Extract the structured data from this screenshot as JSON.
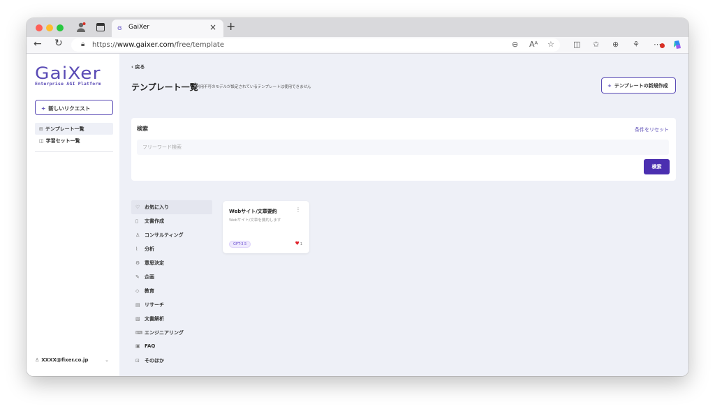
{
  "browser": {
    "tab_title": "GaiXer",
    "tab_close": "×",
    "new_tab": "+",
    "url_prefix": "https://",
    "url_host": "www.gaixer.com",
    "url_path": "/free/template",
    "icons": [
      "zoom-icon",
      "read-aloud-icon",
      "favorite-star-icon",
      "split-screen-icon",
      "favorites-list-icon",
      "collections-icon",
      "extensions-icon",
      "more-icon",
      "copilot-icon"
    ]
  },
  "sidebar": {
    "logo": "GaiXer",
    "tagline": "Enterprise AGI Platform",
    "new_request": "新しいリクエスト",
    "items": [
      {
        "label": "テンプレート一覧",
        "icon": "template-icon",
        "active": true
      },
      {
        "label": "学習セット一覧",
        "icon": "book-icon",
        "active": false
      }
    ],
    "user": "XXXX@fixer.co.jp"
  },
  "main": {
    "back": "戻る",
    "title": "テンプレート一覧",
    "note": "利用不可のモデルが設定されているテンプレートは使用できません",
    "new_template": "テンプレートの新規作成",
    "search": {
      "title": "検索",
      "reset": "条件をリセット",
      "placeholder": "フリーワード検索",
      "button": "検索"
    },
    "categories": [
      {
        "label": "お気に入り",
        "icon": "heart-icon",
        "glyph": "♡"
      },
      {
        "label": "文書作成",
        "icon": "document-icon",
        "glyph": "▯"
      },
      {
        "label": "コンサルティング",
        "icon": "person-icon",
        "glyph": "♙"
      },
      {
        "label": "分析",
        "icon": "chart-icon",
        "glyph": "⌇"
      },
      {
        "label": "意思決定",
        "icon": "decision-icon",
        "glyph": "⚙"
      },
      {
        "label": "企画",
        "icon": "pen-icon",
        "glyph": "✎"
      },
      {
        "label": "教育",
        "icon": "graduation-icon",
        "glyph": "◇"
      },
      {
        "label": "リサーチ",
        "icon": "research-icon",
        "glyph": "▤"
      },
      {
        "label": "文書解析",
        "icon": "document-analysis-icon",
        "glyph": "▧"
      },
      {
        "label": "エンジニアリング",
        "icon": "code-icon",
        "glyph": "⌨"
      },
      {
        "label": "FAQ",
        "icon": "faq-icon",
        "glyph": "▣"
      },
      {
        "label": "そのほか",
        "icon": "other-icon",
        "glyph": "⊡"
      }
    ],
    "template_card": {
      "title": "Webサイト/文章要約",
      "menu": "⋮",
      "description": "Webサイト/文章を要約します",
      "model_badge": "GPT-3.5",
      "likes": "1"
    }
  }
}
